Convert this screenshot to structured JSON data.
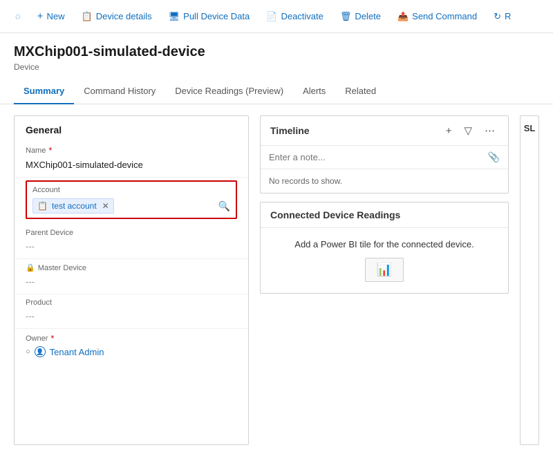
{
  "toolbar": {
    "back_icon": "←",
    "new_label": "New",
    "device_details_label": "Device details",
    "pull_device_data_label": "Pull Device Data",
    "deactivate_label": "Deactivate",
    "delete_label": "Delete",
    "send_command_label": "Send Command",
    "refresh_label": "R"
  },
  "page": {
    "title": "MXChip001-simulated-device",
    "subtitle": "Device"
  },
  "tabs": [
    {
      "id": "summary",
      "label": "Summary",
      "active": true
    },
    {
      "id": "command-history",
      "label": "Command History",
      "active": false
    },
    {
      "id": "device-readings",
      "label": "Device Readings (Preview)",
      "active": false
    },
    {
      "id": "alerts",
      "label": "Alerts",
      "active": false
    },
    {
      "id": "related",
      "label": "Related",
      "active": false
    }
  ],
  "general": {
    "section_label": "General",
    "name_label": "Name",
    "name_value": "MXChip001-simulated-device",
    "account_label": "Account",
    "account_chip_text": "test account",
    "parent_device_label": "Parent Device",
    "parent_device_value": "---",
    "master_device_label": "Master Device",
    "master_device_value": "---",
    "product_label": "Product",
    "product_value": "---",
    "owner_label": "Owner",
    "owner_value": "Tenant Admin"
  },
  "timeline": {
    "title": "Timeline",
    "add_icon": "+",
    "filter_icon": "⛉",
    "more_icon": "···",
    "placeholder": "Enter a note...",
    "empty_text": "No records to show."
  },
  "connected_readings": {
    "title": "Connected Device Readings",
    "description": "Add a Power BI tile for the connected device."
  },
  "sl_panel": {
    "label": "SL"
  }
}
